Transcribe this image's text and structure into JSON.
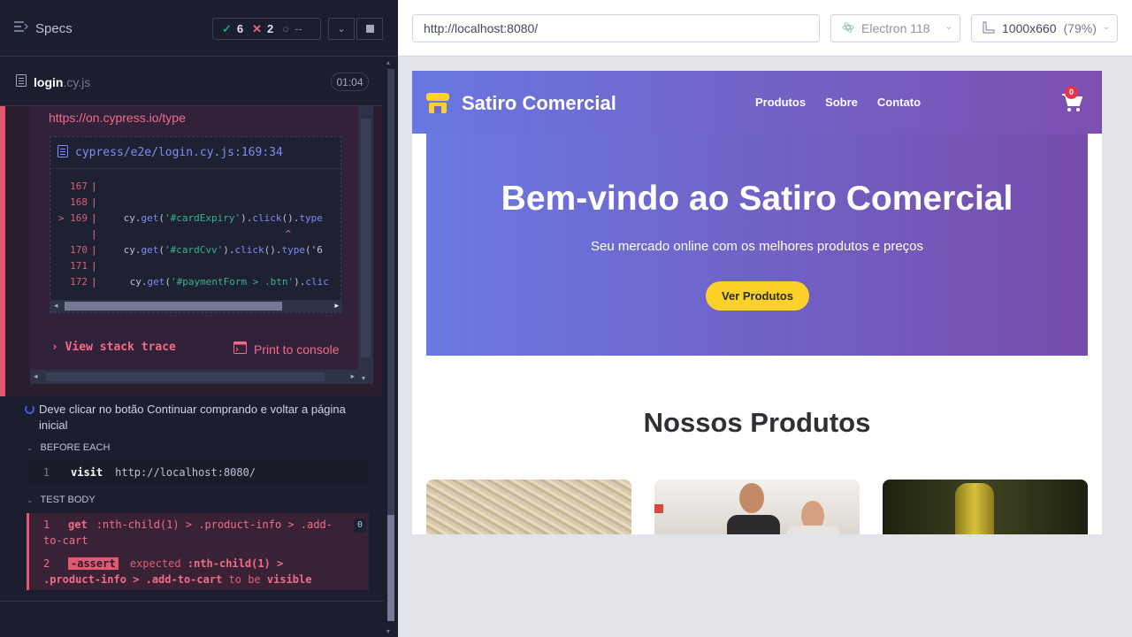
{
  "reporter": {
    "specs_label": "Specs",
    "stats": {
      "passed": "6",
      "failed": "2",
      "pending": "--"
    },
    "spec": {
      "name": "login",
      "ext": ".cy.js",
      "duration": "01:04"
    },
    "error": {
      "docs_url": "https://on.cypress.io/type",
      "codeframe_file": "cypress/e2e/login.cy.js:169:34",
      "lines": [
        {
          "no": "167",
          "code": ""
        },
        {
          "no": "168",
          "code": ""
        },
        {
          "no": "169",
          "code": "cy.get('#cardExpiry').click().type",
          "active": true
        },
        {
          "no": "",
          "code": "^"
        },
        {
          "no": "170",
          "code": "cy.get('#cardCvv').click().type('6"
        },
        {
          "no": "171",
          "code": ""
        },
        {
          "no": "172",
          "code": "cy.get('#paymentForm > .btn').clic"
        }
      ],
      "view_stack": "View stack trace",
      "print_console": "Print to console"
    },
    "test": {
      "title": "Deve clicar no botão Continuar comprando e voltar a página inicial",
      "before_each_label": "BEFORE EACH",
      "test_body_label": "TEST BODY",
      "before_each_cmd": {
        "no": "1",
        "name": "visit",
        "msg": "http://localhost:8080/"
      },
      "body_cmds": [
        {
          "no": "1",
          "name": "get",
          "msg": ":nth-child(1) > .product-info > .add-to-cart",
          "badge": "0"
        },
        {
          "no": "2",
          "name": "-assert",
          "msg1": "expected",
          "msg2": ":nth-child(1) > .product-info > .add-to-cart",
          "msg3": "to be",
          "msg4": "visible"
        }
      ]
    }
  },
  "aut": {
    "url": "http://localhost:8080/",
    "browser": "Electron 118",
    "viewport": "1000x660",
    "scale": "(79%)",
    "site": {
      "brand": "Satiro Comercial",
      "nav": [
        "Produtos",
        "Sobre",
        "Contato"
      ],
      "cart_count": "0",
      "hero_title": "Bem-vindo ao Satiro Comercial",
      "hero_sub": "Seu mercado online com os melhores produtos e preços",
      "hero_button": "Ver Produtos",
      "products_title": "Nossos Produtos"
    }
  },
  "colors": {
    "accent": "#4956e3",
    "fail": "#e45770",
    "pass": "#1fa971",
    "hero_yellow": "#fbd12a"
  }
}
